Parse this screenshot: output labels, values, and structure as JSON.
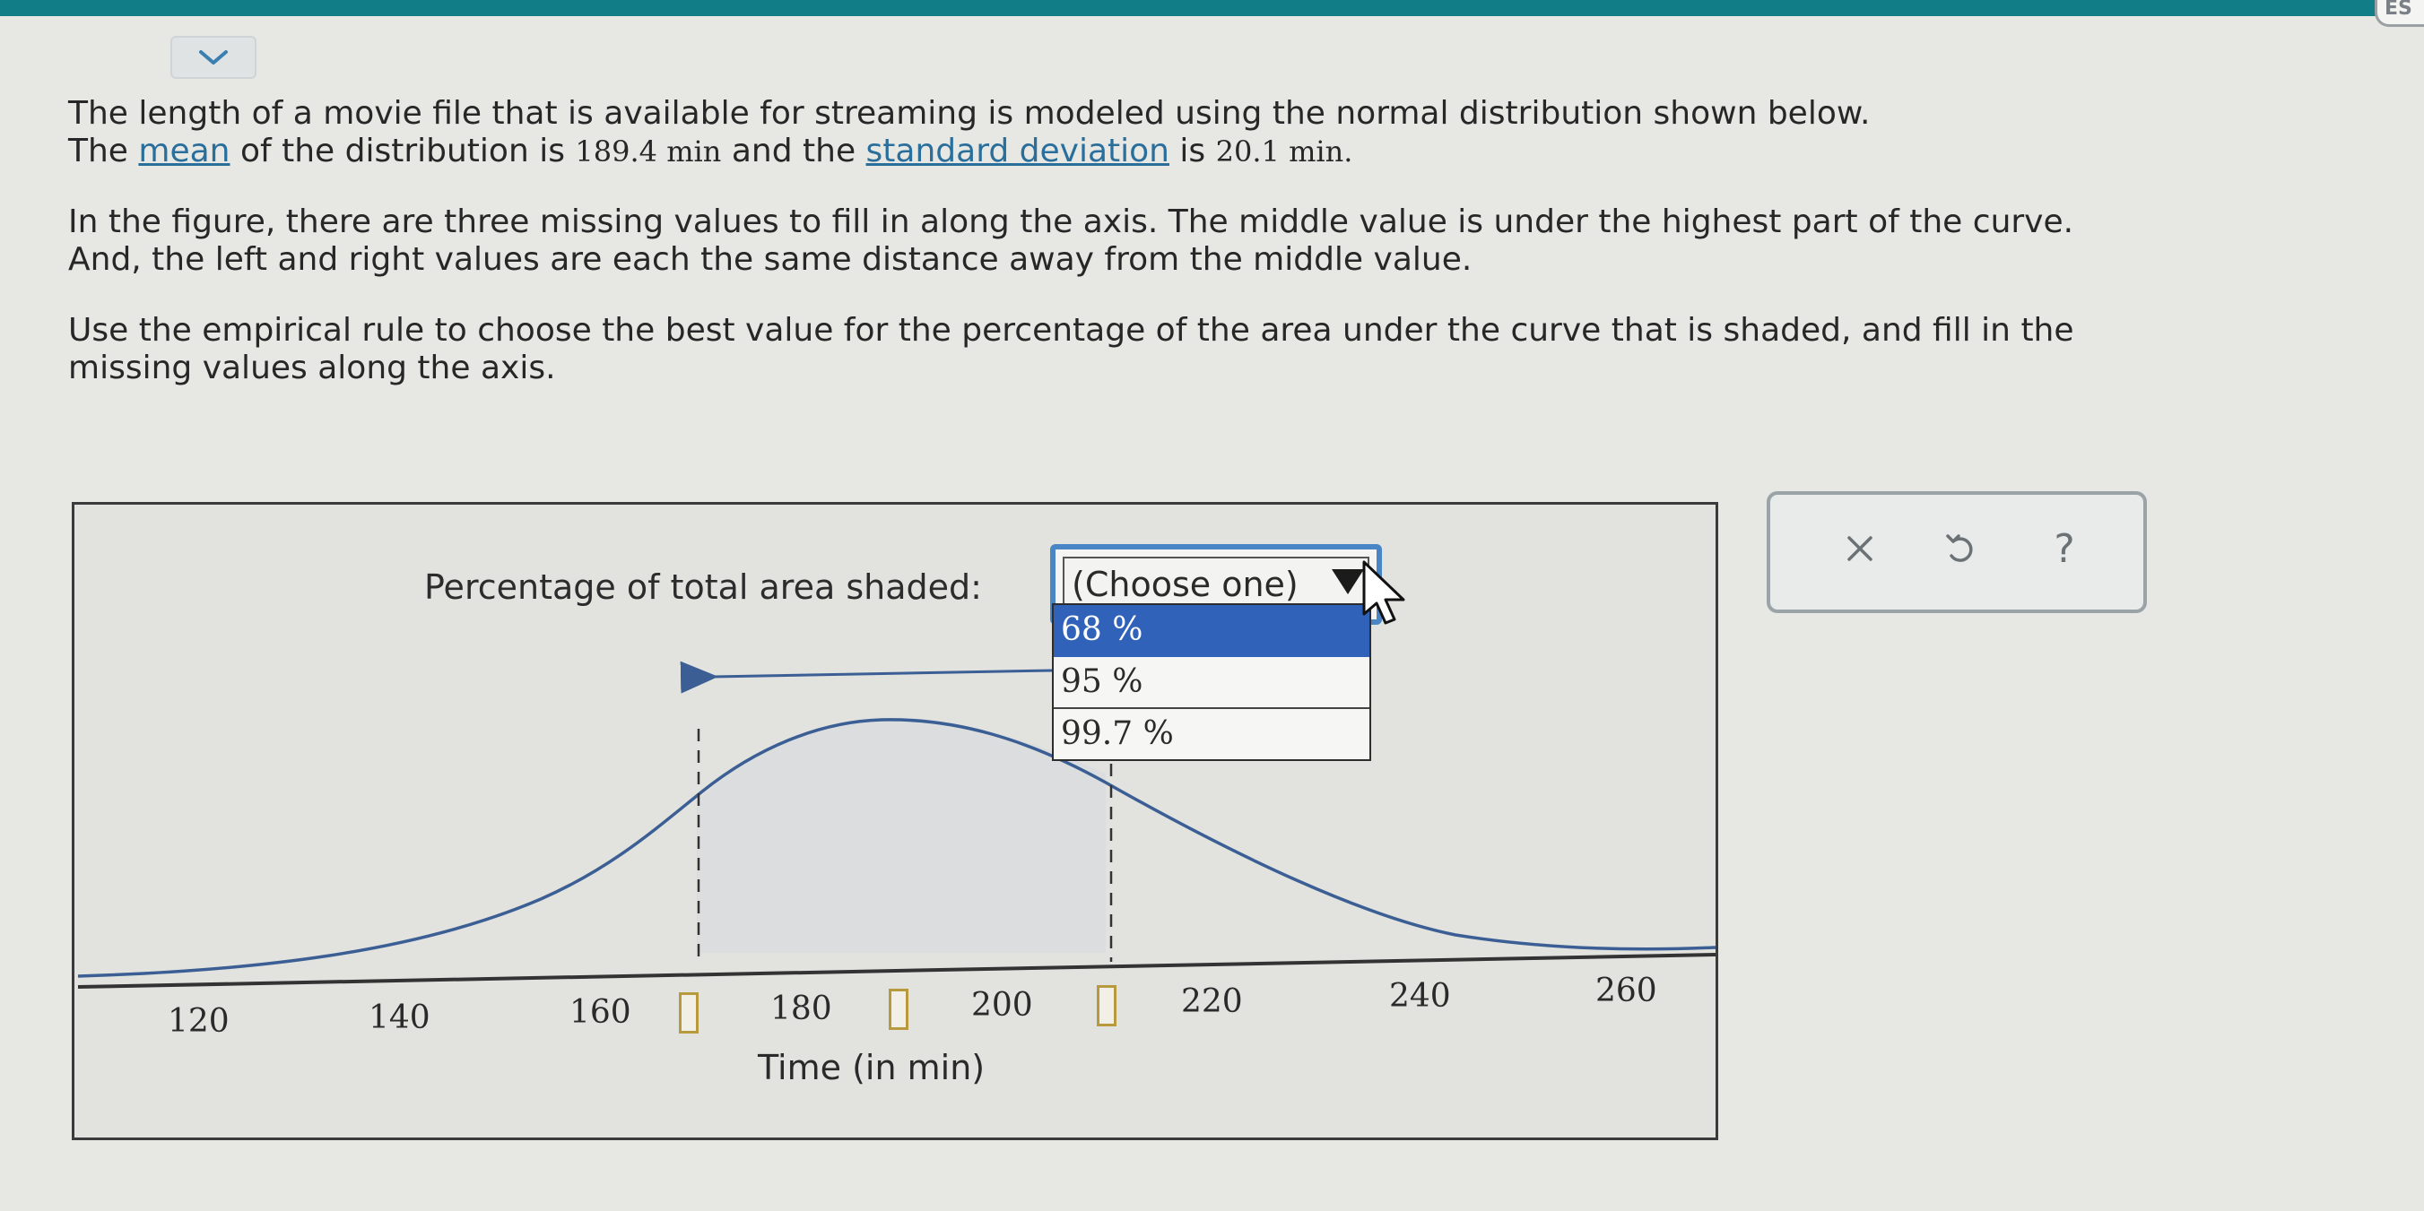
{
  "header": {
    "corner_text": "ES"
  },
  "problem": {
    "p1_a": "The length of a movie file that is available for streaming is modeled using the normal distribution shown below.",
    "p1_b_pre": "The ",
    "mean_link": "mean",
    "p1_b_mid": " of the distribution is ",
    "mean_value": "189.4",
    "p1_b_unit1": " min",
    "p1_b_and": " and the ",
    "sd_link": "standard deviation",
    "p1_b_is": " is ",
    "sd_value": "20.1",
    "p1_b_unit2": " min.",
    "p2_a": "In the figure, there are three missing values to fill in along the axis. The middle value is under the highest part of the curve.",
    "p2_b": "And, the left and right values are each the same distance away from the middle value.",
    "p3_a": "Use the empirical rule to choose the best value for the percentage of the area under the curve that is shaded, and fill in the",
    "p3_b": "missing values along the axis."
  },
  "graph": {
    "pct_label": "Percentage of total area shaded:",
    "select_value": "(Choose one)",
    "options": [
      "68 %",
      "95 %",
      "99.7 %"
    ],
    "selected_option": "68 %",
    "axis_title": "Time (in min)",
    "ticks": [
      "120",
      "140",
      "160",
      "180",
      "200",
      "220",
      "240",
      "260"
    ],
    "answer_boxes": [
      "",
      "",
      ""
    ]
  },
  "tools": {
    "clear_icon": "close-icon",
    "undo_icon": "undo-icon",
    "help_icon": "help-icon"
  }
}
